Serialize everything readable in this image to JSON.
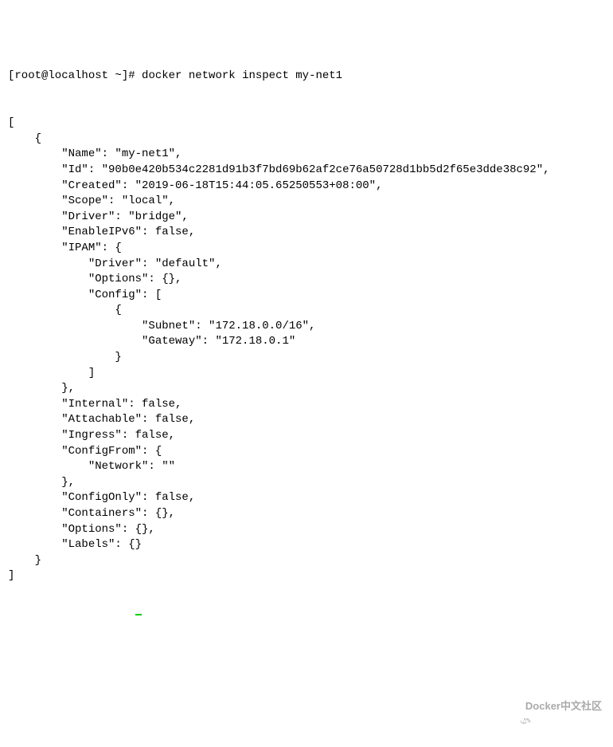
{
  "prompt": {
    "user_host": "[root@localhost ~]#",
    "command": "docker network inspect my-net1"
  },
  "lines": [
    "[",
    "    {",
    "        \"Name\": \"my-net1\",",
    "        \"Id\": \"90b0e420b534c2281d91b3f7bd69b62af2ce76a50728d1bb5d2f65e3dde38c92\",",
    "        \"Created\": \"2019-06-18T15:44:05.65250553+08:00\",",
    "        \"Scope\": \"local\",",
    "        \"Driver\": \"bridge\",",
    "        \"EnableIPv6\": false,",
    "        \"IPAM\": {",
    "            \"Driver\": \"default\",",
    "            \"Options\": {},",
    "            \"Config\": [",
    "                {",
    "                    \"Subnet\": \"172.18.0.0/16\",",
    "                    \"Gateway\": \"172.18.0.1\"",
    "                }",
    "            ]",
    "        },",
    "        \"Internal\": false,",
    "        \"Attachable\": false,",
    "        \"Ingress\": false,",
    "        \"ConfigFrom\": {",
    "            \"Network\": \"\"",
    "        },",
    "        \"ConfigOnly\": false,",
    "        \"Containers\": {},",
    "        \"Options\": {},",
    "        \"Labels\": {}",
    "    }",
    "]"
  ],
  "watermark": {
    "text": "Docker中文社区"
  }
}
